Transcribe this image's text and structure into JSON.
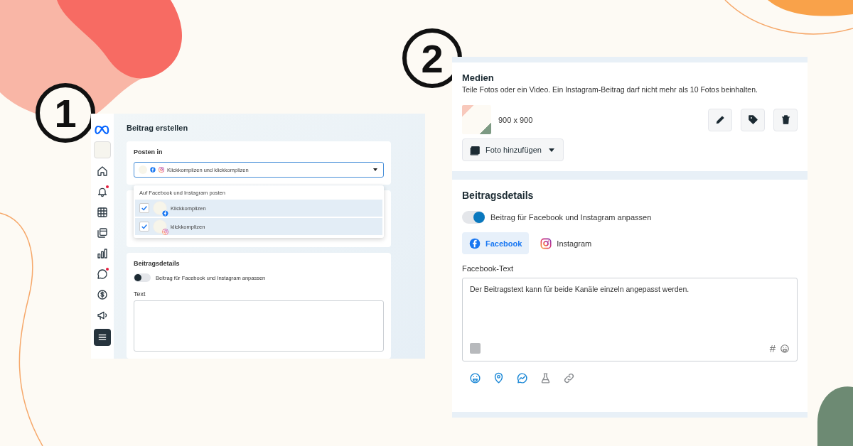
{
  "steps": [
    {
      "label": "1"
    },
    {
      "label": "2"
    }
  ],
  "screen_1": {
    "sidebar": {
      "items": [
        {
          "kind": "meta",
          "notification": false,
          "selected": false
        },
        {
          "kind": "account",
          "notification": false,
          "selected": false
        },
        {
          "kind": "home",
          "notification": false,
          "selected": false
        },
        {
          "kind": "bell",
          "notification": true,
          "selected": false
        },
        {
          "kind": "grid",
          "notification": false,
          "selected": false
        },
        {
          "kind": "layers",
          "notification": false,
          "selected": false
        },
        {
          "kind": "chart",
          "notification": false,
          "selected": false
        },
        {
          "kind": "chat",
          "notification": true,
          "selected": false
        },
        {
          "kind": "dollar",
          "notification": false,
          "selected": false
        },
        {
          "kind": "megaphone",
          "notification": false,
          "selected": false
        },
        {
          "kind": "menu",
          "notification": false,
          "selected": true
        }
      ]
    },
    "title": "Beitrag erstellen",
    "post_in": {
      "label": "Posten in",
      "value": "Klickkomplizen und klickkomplizen",
      "dropdown_header": "Auf Facebook und Instagram posten",
      "options": [
        {
          "label": "Klickkomplizen",
          "kind": "facebook",
          "checked": true
        },
        {
          "label": "klickkomplizen",
          "kind": "instagram",
          "checked": true
        }
      ]
    },
    "details": {
      "title": "Beitragsdetails",
      "toggle": {
        "label": "Beitrag für Facebook und Instagram anpassen",
        "on": false
      },
      "text_label": "Text"
    }
  },
  "screen_2": {
    "media": {
      "title": "Medien",
      "description": "Teile Fotos oder ein Video. Ein Instagram-Beitrag darf nicht mehr als 10 Fotos beinhalten.",
      "photo_size": "900 x 900",
      "actions": [
        {
          "kind": "edit"
        },
        {
          "kind": "tag"
        },
        {
          "kind": "delete"
        }
      ],
      "add_button": "Foto hinzufügen"
    },
    "details": {
      "title": "Beitragsdetails",
      "toggle": {
        "label": "Beitrag für Facebook und Instagram anpassen",
        "on": true
      },
      "tabs": [
        {
          "label": "Facebook",
          "kind": "facebook",
          "selected": true
        },
        {
          "label": "Instagram",
          "kind": "instagram",
          "selected": false
        }
      ],
      "text_label": "Facebook-Text",
      "text_value": "Der Beitragstext kann für beide Kanäle einzeln angepasst werden.",
      "hashtag": "#",
      "tools": [
        {
          "kind": "emoji"
        },
        {
          "kind": "location"
        },
        {
          "kind": "messenger"
        },
        {
          "kind": "flask"
        },
        {
          "kind": "link"
        }
      ]
    }
  }
}
